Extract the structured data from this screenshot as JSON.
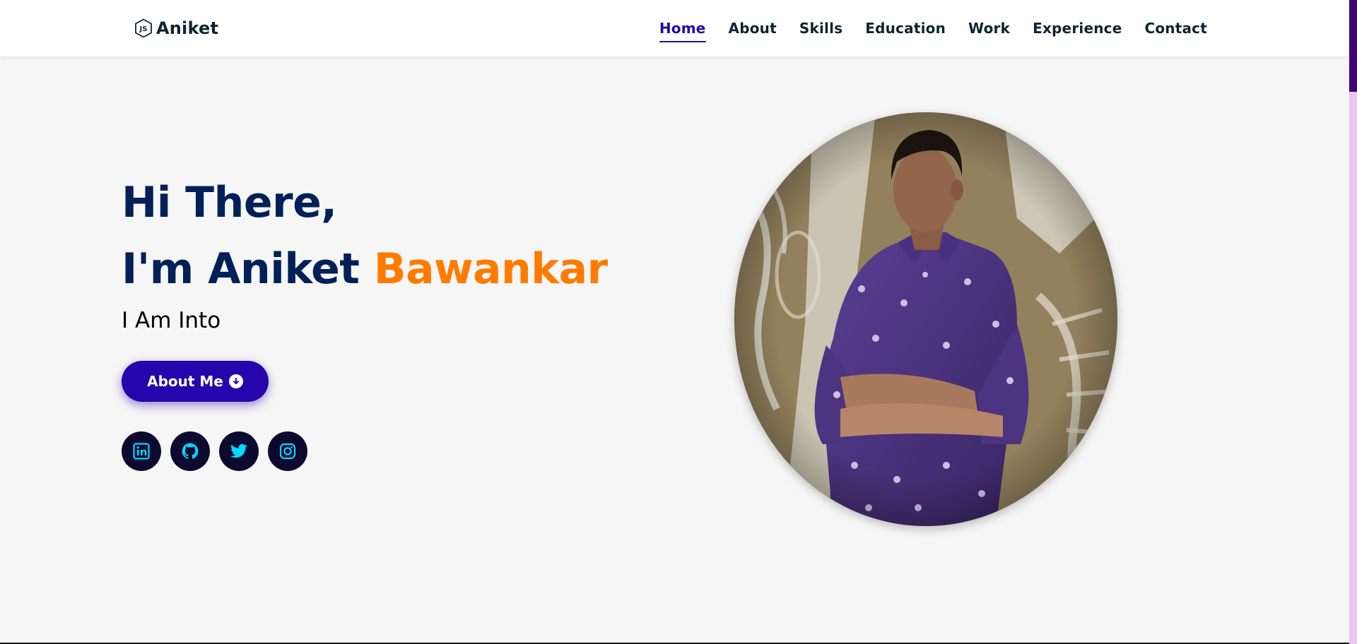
{
  "header": {
    "logo_text": "Aniket",
    "nav": [
      {
        "label": "Home",
        "active": true
      },
      {
        "label": "About"
      },
      {
        "label": "Skills"
      },
      {
        "label": "Education"
      },
      {
        "label": "Work"
      },
      {
        "label": "Experience"
      },
      {
        "label": "Contact"
      }
    ]
  },
  "hero": {
    "greeting_line1": "Hi There,",
    "greeting_line2_prefix": "I'm Aniket ",
    "greeting_line2_accent": "Bawankar",
    "subtitle": "I Am Into",
    "about_button": "About Me",
    "socials": [
      {
        "icon": "linkedin-icon"
      },
      {
        "icon": "github-icon"
      },
      {
        "icon": "twitter-icon"
      },
      {
        "icon": "instagram-icon"
      }
    ]
  },
  "colors": {
    "primary": "#2506ad",
    "heading": "#002057",
    "accent": "#ff7b00",
    "nav_text": "#0e2431",
    "social_bg": "#0c0a2e",
    "social_icon": "#00d9ff",
    "scroll_track": "#e9c7f1",
    "scroll_thumb": "#420177"
  }
}
